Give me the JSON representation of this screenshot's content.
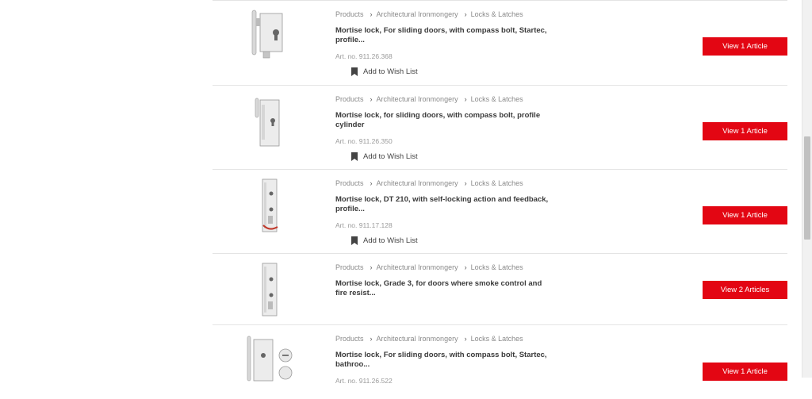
{
  "products": [
    {
      "breadcrumb": [
        "Products",
        "Architectural Ironmongery",
        "Locks & Latches"
      ],
      "title": "Mortise lock, For sliding doors, with compass bolt, Startec, profile...",
      "art_no": "Art. no. 911.26.368",
      "wish_label": "Add to Wish List",
      "button_label": "View 1 Article"
    },
    {
      "breadcrumb": [
        "Products",
        "Architectural Ironmongery",
        "Locks & Latches"
      ],
      "title": "Mortise lock, for sliding doors, with compass bolt, profile cylinder",
      "art_no": "Art. no. 911.26.350",
      "wish_label": "Add to Wish List",
      "button_label": "View 1 Article"
    },
    {
      "breadcrumb": [
        "Products",
        "Architectural Ironmongery",
        "Locks & Latches"
      ],
      "title": "Mortise lock, DT 210, with self-locking action and feedback, profile...",
      "art_no": "Art. no. 911.17.128",
      "wish_label": "Add to Wish List",
      "button_label": "View 1 Article"
    },
    {
      "breadcrumb": [
        "Products",
        "Architectural Ironmongery",
        "Locks & Latches"
      ],
      "title": "Mortise lock, Grade 3, for doors where smoke control and fire resist...",
      "button_label": "View 2 Articles"
    },
    {
      "breadcrumb": [
        "Products",
        "Architectural Ironmongery",
        "Locks & Latches"
      ],
      "title": "Mortise lock, For sliding doors, with compass bolt, Startec, bathroo...",
      "art_no": "Art. no. 911.26.522",
      "button_label": "View 1 Article"
    }
  ],
  "colors": {
    "accent": "#e30613",
    "muted_text": "#8a8a8a",
    "divider": "#e4e4e4"
  },
  "icons": {
    "wish": "bookmark-icon",
    "breadcrumb_separator": "chevron-right-icon"
  }
}
